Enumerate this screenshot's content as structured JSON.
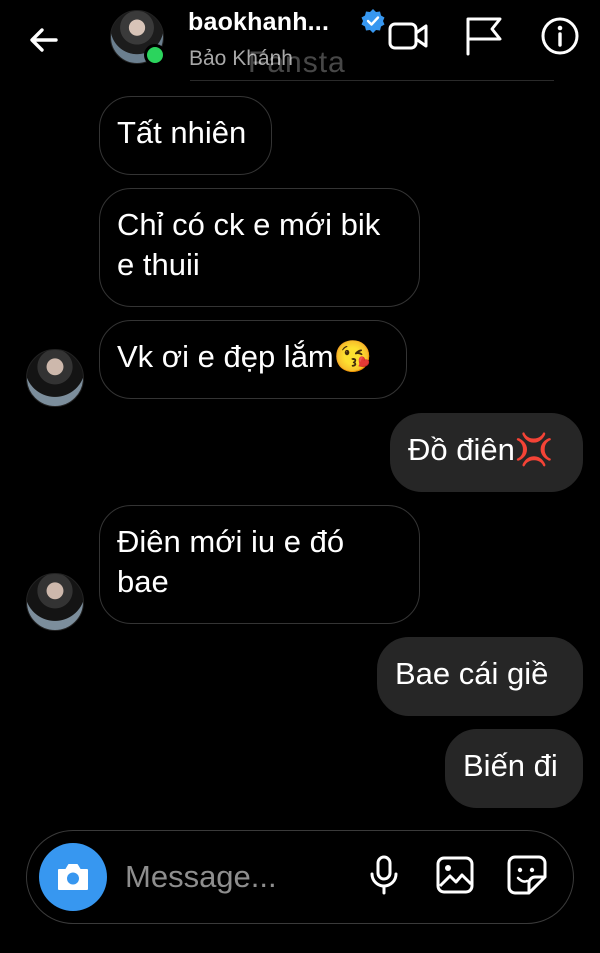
{
  "header": {
    "username": "baokhanh...",
    "display_name": "Bảo Khánh",
    "watermark": "Fansta",
    "icons": [
      "back-arrow-icon",
      "verified-badge-icon",
      "video-call-icon",
      "flag-icon",
      "info-icon"
    ],
    "colors": {
      "online": "#2bd45d",
      "verified": "#3797f0"
    }
  },
  "messages": [
    {
      "sender": "them",
      "text": "Tất nhiên"
    },
    {
      "sender": "them",
      "text": "Chỉ có ck e mới bik e thuii"
    },
    {
      "sender": "them",
      "text": "Vk ơi e đẹp lắm😘"
    },
    {
      "sender": "me",
      "text": "Đồ điên💢"
    },
    {
      "sender": "them",
      "text": "Điên mới iu e đó bae"
    },
    {
      "sender": "me",
      "text": "Bae cái giề"
    },
    {
      "sender": "me",
      "text": "Biến đi"
    }
  ],
  "composer": {
    "placeholder": "Message...",
    "icons": [
      "camera-icon",
      "microphone-icon",
      "gallery-icon",
      "sticker-icon"
    ],
    "colors": {
      "camera_button": "#3797f0",
      "outgoing_bubble": "#262626"
    }
  }
}
